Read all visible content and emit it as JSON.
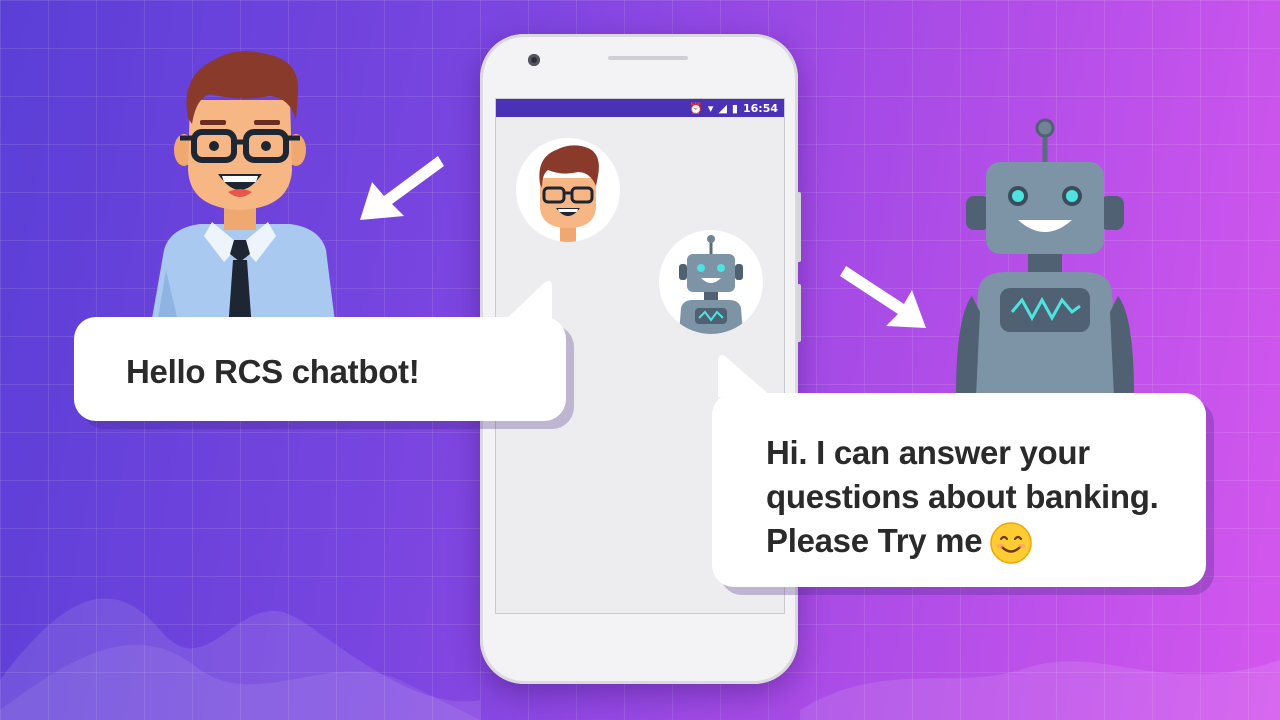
{
  "phone": {
    "status_time": "16:54",
    "status_icons": [
      "alarm-icon",
      "wifi-icon",
      "signal-icon",
      "battery-icon"
    ]
  },
  "messages": {
    "user": "Hello RCS chatbot!",
    "bot_lines": [
      "Hi. I can answer your",
      "questions about banking.",
      "Please Try me"
    ]
  },
  "icons": {
    "emoji": "smiling-face-emoji",
    "user_avatar": "man-avatar",
    "bot_avatar": "robot-avatar"
  },
  "colors": {
    "status_bar": "#4a31b5",
    "background_start": "#5a3fd6",
    "background_end": "#d457ee"
  }
}
